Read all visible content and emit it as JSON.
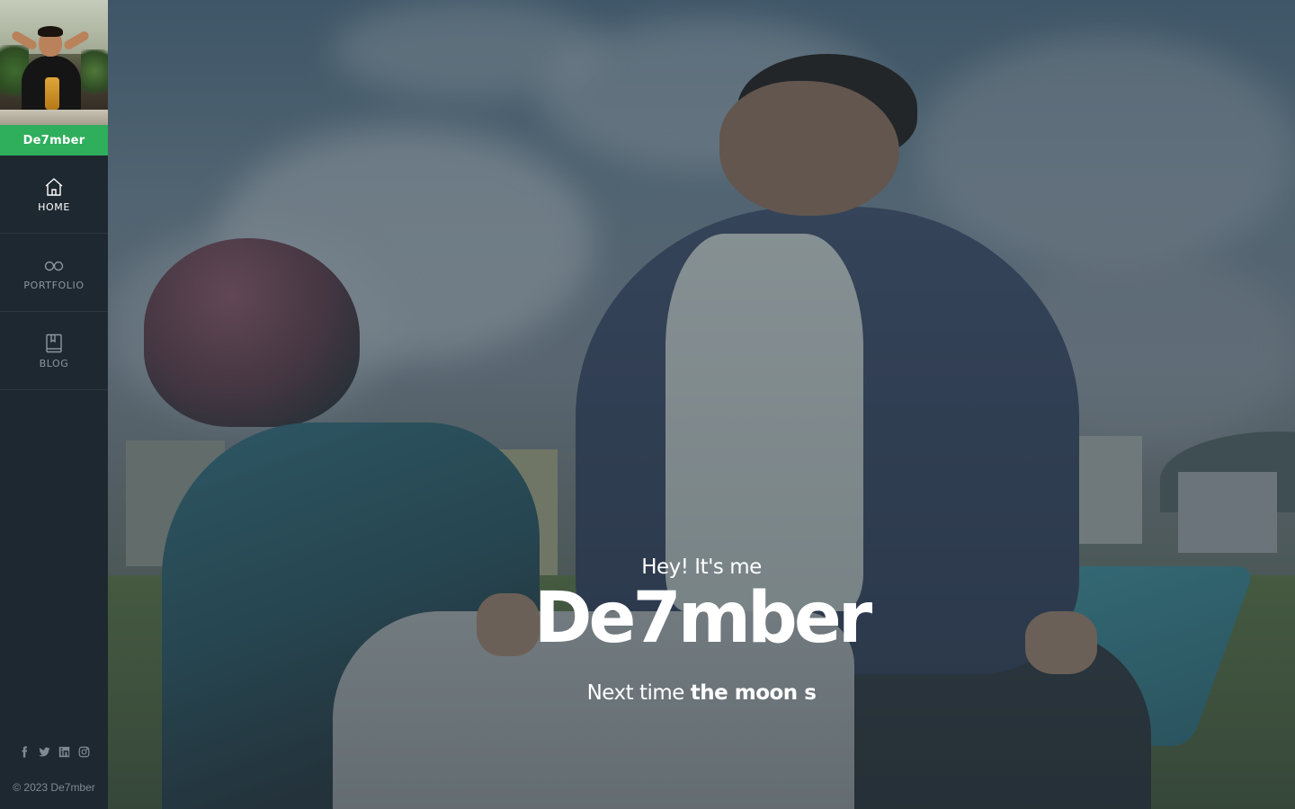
{
  "sidebar": {
    "brand": "De7mber",
    "nav": [
      {
        "label": "HOME",
        "icon": "home-icon",
        "active": true
      },
      {
        "label": "PORTFOLIO",
        "icon": "glasses-icon",
        "active": false
      },
      {
        "label": "BLOG",
        "icon": "book-icon",
        "active": false
      }
    ],
    "social": [
      "facebook-icon",
      "twitter-icon",
      "linkedin-icon",
      "instagram-icon"
    ],
    "copyright": "© 2023 De7mber"
  },
  "hero": {
    "greeting": "Hey! It's me",
    "name": "De7mber",
    "tagline_prefix": "Next time",
    "tagline_bold": "the moon s"
  },
  "colors": {
    "brand_green": "#2fae5c",
    "sidebar_bg": "#1e2830",
    "text_muted": "#7f8a94"
  }
}
